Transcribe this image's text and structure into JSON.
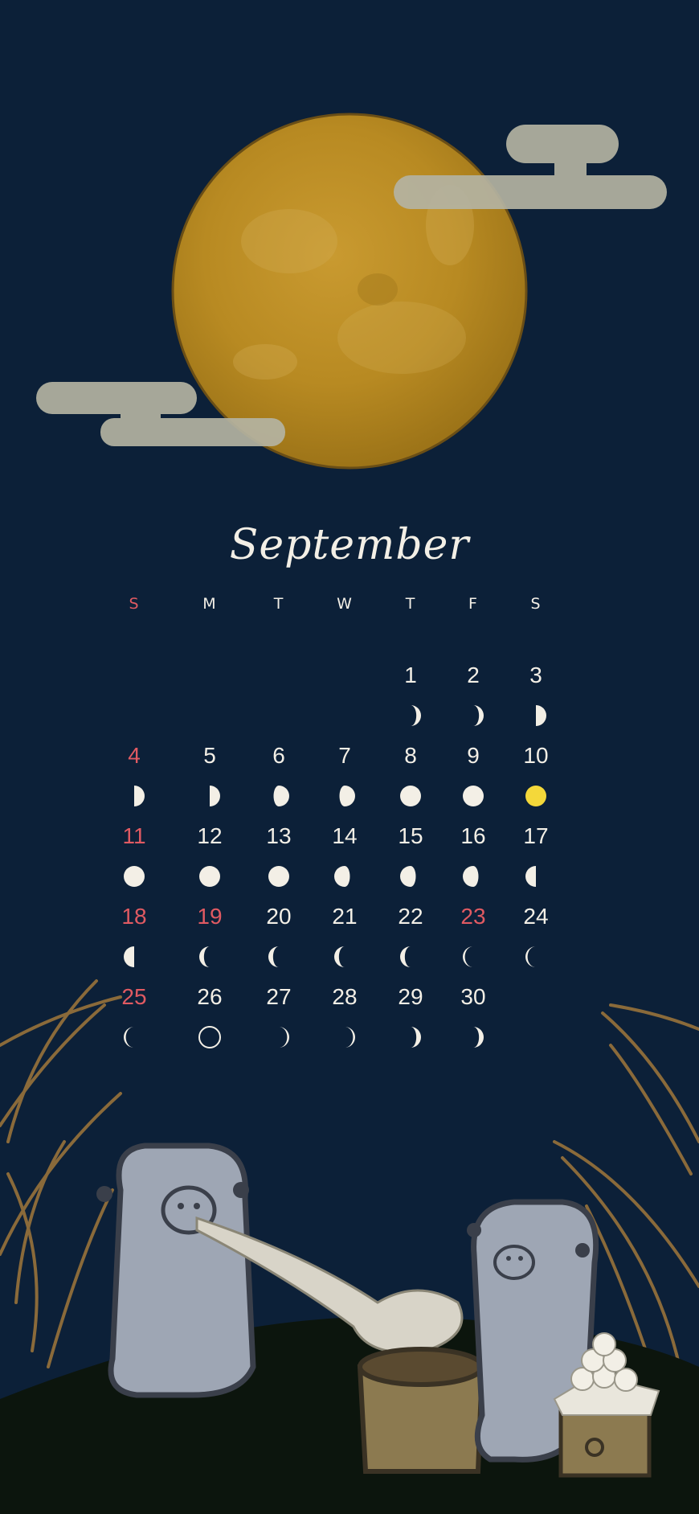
{
  "calendar": {
    "month": "September",
    "weekdays": [
      "S",
      "M",
      "T",
      "W",
      "T",
      "F",
      "S"
    ],
    "colors": {
      "background": "#0c2038",
      "text": "#f3efe6",
      "holiday": "#e05a62",
      "full_moon_highlight": "#f4d83a",
      "moon_gold": "#b98a22",
      "cloud": "#b4b3a2"
    },
    "weeks": [
      {
        "days": [
          "",
          "",
          "",
          "",
          "1",
          "2",
          "3"
        ],
        "moons": [
          "",
          "",
          "",
          "",
          "waxing-crescent",
          "waxing-crescent",
          "first-quarter"
        ],
        "holiday": [
          false,
          false,
          false,
          false,
          false,
          false,
          false
        ]
      },
      {
        "days": [
          "4",
          "5",
          "6",
          "7",
          "8",
          "9",
          "10"
        ],
        "moons": [
          "first-quarter",
          "first-quarter",
          "waxing-gibbous",
          "waxing-gibbous",
          "full",
          "full",
          "full-highlight"
        ],
        "holiday": [
          true,
          false,
          false,
          false,
          false,
          false,
          false
        ]
      },
      {
        "days": [
          "11",
          "12",
          "13",
          "14",
          "15",
          "16",
          "17"
        ],
        "moons": [
          "full",
          "full",
          "full",
          "waning-gibbous",
          "waning-gibbous",
          "waning-gibbous",
          "last-quarter"
        ],
        "holiday": [
          true,
          false,
          false,
          false,
          false,
          false,
          false
        ]
      },
      {
        "days": [
          "18",
          "19",
          "20",
          "21",
          "22",
          "23",
          "24"
        ],
        "moons": [
          "last-quarter",
          "waning-crescent",
          "waning-crescent",
          "waning-crescent",
          "waning-crescent",
          "thin-waning",
          "thin-waning"
        ],
        "holiday": [
          true,
          true,
          false,
          false,
          false,
          true,
          false
        ]
      },
      {
        "days": [
          "25",
          "26",
          "27",
          "28",
          "29",
          "30",
          ""
        ],
        "moons": [
          "thin-waning",
          "new",
          "thin-waxing",
          "thin-waxing",
          "waxing-crescent",
          "waxing-crescent",
          ""
        ],
        "holiday": [
          true,
          false,
          false,
          false,
          false,
          false,
          false
        ]
      }
    ]
  }
}
